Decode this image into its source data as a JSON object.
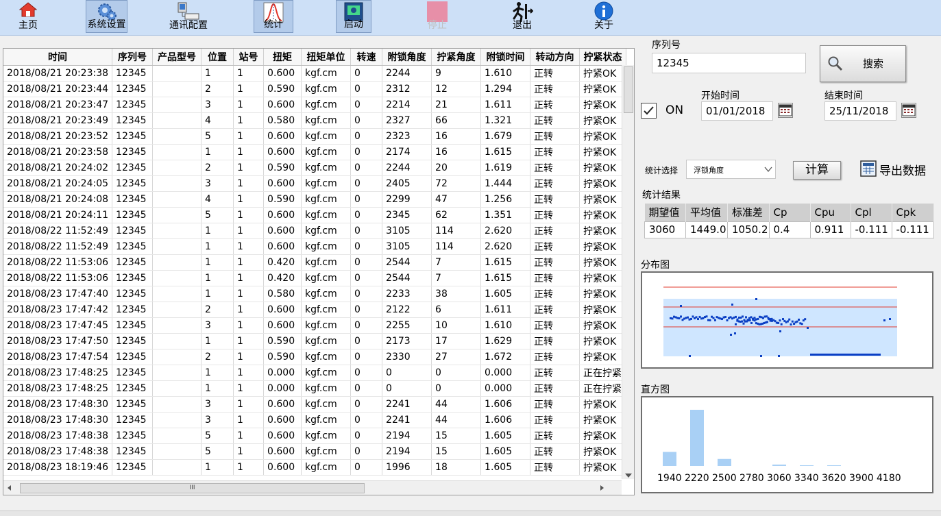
{
  "toolbar": {
    "buttons": [
      {
        "label": "主页",
        "icon": "home-icon"
      },
      {
        "label": "系统设置",
        "icon": "settings-gear-icon"
      },
      {
        "label": "通讯配置",
        "icon": "network-computer-icon"
      },
      {
        "label": "统计",
        "icon": "statistics-curve-icon"
      },
      {
        "label": "启动",
        "icon": "start-monitor-icon"
      },
      {
        "label": "停止",
        "icon": "stop-square-icon"
      },
      {
        "label": "退出",
        "icon": "exit-runner-icon"
      },
      {
        "label": "关于",
        "icon": "info-icon"
      }
    ]
  },
  "table": {
    "columns": [
      "时间",
      "序列号",
      "产品型号",
      "位置",
      "站号",
      "扭矩",
      "扭矩单位",
      "转速",
      "附锁角度",
      "拧紧角度",
      "附锁时间",
      "转动方向",
      "拧紧状态"
    ],
    "rows": [
      [
        "2018/08/21 20:23:38",
        "12345",
        "",
        "1",
        "1",
        "0.600",
        "kgf.cm",
        "0",
        "2244",
        "9",
        "1.610",
        "正转",
        "拧紧OK"
      ],
      [
        "2018/08/21 20:23:44",
        "12345",
        "",
        "2",
        "1",
        "0.590",
        "kgf.cm",
        "0",
        "2312",
        "12",
        "1.294",
        "正转",
        "拧紧OK"
      ],
      [
        "2018/08/21 20:23:47",
        "12345",
        "",
        "3",
        "1",
        "0.600",
        "kgf.cm",
        "0",
        "2214",
        "21",
        "1.611",
        "正转",
        "拧紧OK"
      ],
      [
        "2018/08/21 20:23:49",
        "12345",
        "",
        "4",
        "1",
        "0.580",
        "kgf.cm",
        "0",
        "2327",
        "66",
        "1.321",
        "正转",
        "拧紧OK"
      ],
      [
        "2018/08/21 20:23:52",
        "12345",
        "",
        "5",
        "1",
        "0.600",
        "kgf.cm",
        "0",
        "2323",
        "16",
        "1.679",
        "正转",
        "拧紧OK"
      ],
      [
        "2018/08/21 20:23:58",
        "12345",
        "",
        "1",
        "1",
        "0.600",
        "kgf.cm",
        "0",
        "2174",
        "16",
        "1.615",
        "正转",
        "拧紧OK"
      ],
      [
        "2018/08/21 20:24:02",
        "12345",
        "",
        "2",
        "1",
        "0.590",
        "kgf.cm",
        "0",
        "2244",
        "20",
        "1.619",
        "正转",
        "拧紧OK"
      ],
      [
        "2018/08/21 20:24:05",
        "12345",
        "",
        "3",
        "1",
        "0.600",
        "kgf.cm",
        "0",
        "2405",
        "72",
        "1.444",
        "正转",
        "拧紧OK"
      ],
      [
        "2018/08/21 20:24:08",
        "12345",
        "",
        "4",
        "1",
        "0.590",
        "kgf.cm",
        "0",
        "2299",
        "47",
        "1.256",
        "正转",
        "拧紧OK"
      ],
      [
        "2018/08/21 20:24:11",
        "12345",
        "",
        "5",
        "1",
        "0.600",
        "kgf.cm",
        "0",
        "2345",
        "62",
        "1.351",
        "正转",
        "拧紧OK"
      ],
      [
        "2018/08/22 11:52:49",
        "12345",
        "",
        "1",
        "1",
        "0.600",
        "kgf.cm",
        "0",
        "3105",
        "114",
        "2.620",
        "正转",
        "拧紧OK"
      ],
      [
        "2018/08/22 11:52:49",
        "12345",
        "",
        "1",
        "1",
        "0.600",
        "kgf.cm",
        "0",
        "3105",
        "114",
        "2.620",
        "正转",
        "拧紧OK"
      ],
      [
        "2018/08/22 11:53:06",
        "12345",
        "",
        "1",
        "1",
        "0.420",
        "kgf.cm",
        "0",
        "2544",
        "7",
        "1.615",
        "正转",
        "拧紧OK"
      ],
      [
        "2018/08/22 11:53:06",
        "12345",
        "",
        "1",
        "1",
        "0.420",
        "kgf.cm",
        "0",
        "2544",
        "7",
        "1.615",
        "正转",
        "拧紧OK"
      ],
      [
        "2018/08/23 17:47:40",
        "12345",
        "",
        "1",
        "1",
        "0.580",
        "kgf.cm",
        "0",
        "2233",
        "38",
        "1.605",
        "正转",
        "拧紧OK"
      ],
      [
        "2018/08/23 17:47:42",
        "12345",
        "",
        "2",
        "1",
        "0.600",
        "kgf.cm",
        "0",
        "2122",
        "6",
        "1.611",
        "正转",
        "拧紧OK"
      ],
      [
        "2018/08/23 17:47:45",
        "12345",
        "",
        "3",
        "1",
        "0.600",
        "kgf.cm",
        "0",
        "2255",
        "10",
        "1.610",
        "正转",
        "拧紧OK"
      ],
      [
        "2018/08/23 17:47:50",
        "12345",
        "",
        "1",
        "1",
        "0.590",
        "kgf.cm",
        "0",
        "2173",
        "17",
        "1.629",
        "正转",
        "拧紧OK"
      ],
      [
        "2018/08/23 17:47:54",
        "12345",
        "",
        "2",
        "1",
        "0.590",
        "kgf.cm",
        "0",
        "2330",
        "27",
        "1.672",
        "正转",
        "拧紧OK"
      ],
      [
        "2018/08/23 17:48:25",
        "12345",
        "",
        "1",
        "1",
        "0.000",
        "kgf.cm",
        "0",
        "0",
        "0",
        "0.000",
        "正转",
        "正在拧紧"
      ],
      [
        "2018/08/23 17:48:25",
        "12345",
        "",
        "1",
        "1",
        "0.000",
        "kgf.cm",
        "0",
        "0",
        "0",
        "0.000",
        "正转",
        "正在拧紧"
      ],
      [
        "2018/08/23 17:48:30",
        "12345",
        "",
        "3",
        "1",
        "0.600",
        "kgf.cm",
        "0",
        "2241",
        "44",
        "1.606",
        "正转",
        "拧紧OK"
      ],
      [
        "2018/08/23 17:48:30",
        "12345",
        "",
        "3",
        "1",
        "0.600",
        "kgf.cm",
        "0",
        "2241",
        "44",
        "1.606",
        "正转",
        "拧紧OK"
      ],
      [
        "2018/08/23 17:48:38",
        "12345",
        "",
        "5",
        "1",
        "0.600",
        "kgf.cm",
        "0",
        "2194",
        "15",
        "1.605",
        "正转",
        "拧紧OK"
      ],
      [
        "2018/08/23 17:48:38",
        "12345",
        "",
        "5",
        "1",
        "0.600",
        "kgf.cm",
        "0",
        "2194",
        "15",
        "1.605",
        "正转",
        "拧紧OK"
      ],
      [
        "2018/08/23 18:19:46",
        "12345",
        "",
        "1",
        "1",
        "0.600",
        "kgf.cm",
        "0",
        "1996",
        "18",
        "1.605",
        "正转",
        "拧紧OK"
      ]
    ],
    "hscroll_grip": "III"
  },
  "search": {
    "serial_label": "序列号",
    "serial_value": "12345",
    "search_button": "搜索"
  },
  "filter": {
    "on_label": "ON",
    "on_checked": true,
    "start_label": "开始时间",
    "start_value": "01/01/2018",
    "end_label": "结束时间",
    "end_value": "25/11/2018"
  },
  "stats": {
    "select_label": "统计选择",
    "select_value": "浮锁角度",
    "calc_button": "计算",
    "export_button": "导出数据",
    "result_label": "统计结果",
    "headers": [
      "期望值",
      "平均值",
      "标准差",
      "Cp",
      "Cpu",
      "Cpl",
      "Cpk"
    ],
    "values": [
      "3060",
      "1449.0",
      "1050.2",
      "0.4",
      "0.911",
      "-0.111",
      "-0.111"
    ]
  },
  "distribution": {
    "label": "分布图",
    "colors": {
      "band": "#cfe6ff",
      "limit": "#e03a2e",
      "point": "#0b3fc4"
    }
  },
  "histogram": {
    "label": "直方图",
    "chart_data": {
      "type": "bar",
      "categories": [
        "1940",
        "2220",
        "2500",
        "2780",
        "3060",
        "3340",
        "3620",
        "3900",
        "4180"
      ],
      "values": [
        6,
        24,
        3,
        0,
        0.6,
        0.3,
        0.3,
        0,
        0
      ],
      "bar_color": "#a9d0f5"
    }
  }
}
